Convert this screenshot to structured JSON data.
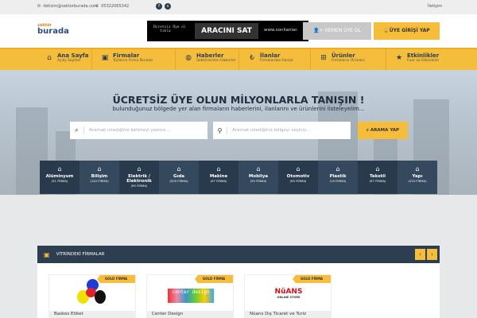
{
  "topbar": {
    "email": "iletisim@sektorburada.com",
    "phone": "05322065342",
    "social": [
      "facebook-icon",
      "skype-icon"
    ],
    "right_link": "İletişim"
  },
  "header": {
    "logo_top": "sektör",
    "logo_main": "burada",
    "ad": {
      "line1": "Ücretsiz Üye ol",
      "line2": "tıkla",
      "title": "ARACINI SAT",
      "url": "www.sonilanlar."
    },
    "register": "HEMEN ÜYE OL",
    "login": "ÜYE GİRİŞİ YAP"
  },
  "nav": [
    {
      "icon": "home-icon",
      "glyph": "⌂",
      "title": "Ana Sayfa",
      "sub": "Açılış Sayfası"
    },
    {
      "icon": "briefcase-icon",
      "glyph": "▣",
      "title": "Firmalar",
      "sub": "Yüzlerce Firma Burada"
    },
    {
      "icon": "globe-icon",
      "glyph": "◍",
      "title": "Haberler",
      "sub": "Sektörlerden Haberler"
    },
    {
      "icon": "lira-icon",
      "glyph": "₺",
      "title": "İlanlar",
      "sub": "Firmalardan İlanlar"
    },
    {
      "icon": "gift-icon",
      "glyph": "⊞",
      "title": "Ürünler",
      "sub": "Firmaların Ürünleri"
    },
    {
      "icon": "star-icon",
      "glyph": "★",
      "title": "Etkinlikler",
      "sub": "Fuar ve Etkinlikler"
    }
  ],
  "hero": {
    "title": "ÜCRETSİZ ÜYE OLUN MİLYONLARLA TANIŞIN !",
    "subtitle": "bulunduğunuz bölgede yer alan firmaların haberlerini, ilanlarını ve ürünlerini listeleyelim...",
    "keyword_placeholder": "Aramak istediğiniz kelimeyi yazınız...",
    "region_placeholder": "Aramak istediğiniz bölgeyi seçiniz...",
    "search_button": "ARAMA YAP"
  },
  "categories": [
    {
      "name": "Alüminyum",
      "count": "(31 FİRMA)"
    },
    {
      "name": "Bilişim",
      "count": "(142 FİRMA)"
    },
    {
      "name": "Elektrik / Elektronik",
      "count": "(95 FİRMA)"
    },
    {
      "name": "Gıda",
      "count": "(505 FİRMA)"
    },
    {
      "name": "Makine",
      "count": "(97 FİRMA)"
    },
    {
      "name": "Mobilya",
      "count": "(55 FİRMA)"
    },
    {
      "name": "Otomotiv",
      "count": "(95 FİRMA)"
    },
    {
      "name": "Plastik",
      "count": "(19 FİRMA)"
    },
    {
      "name": "Tekstil",
      "count": "(97 FİRMA)"
    },
    {
      "name": "Yapı",
      "count": "(225 FİRMA)"
    }
  ],
  "showcase": {
    "title": "VİTRİNDEKİ FİRMALAR",
    "prev": "‹",
    "next": "›",
    "cards": [
      {
        "badge": "GOLD FİRMA",
        "name": "Baskos Etiket"
      },
      {
        "badge": "GOLD FİRMA",
        "name": "Center Design",
        "logo": "center design"
      },
      {
        "badge": "GOLD FİRMA",
        "name": "Nüans Dış Ticaret ve Turiz",
        "logo": "NüANS",
        "logo_sub": "ONLINE STORE"
      }
    ]
  },
  "colors": {
    "accent": "#f5bd3c",
    "dark": "#2c3e50"
  }
}
